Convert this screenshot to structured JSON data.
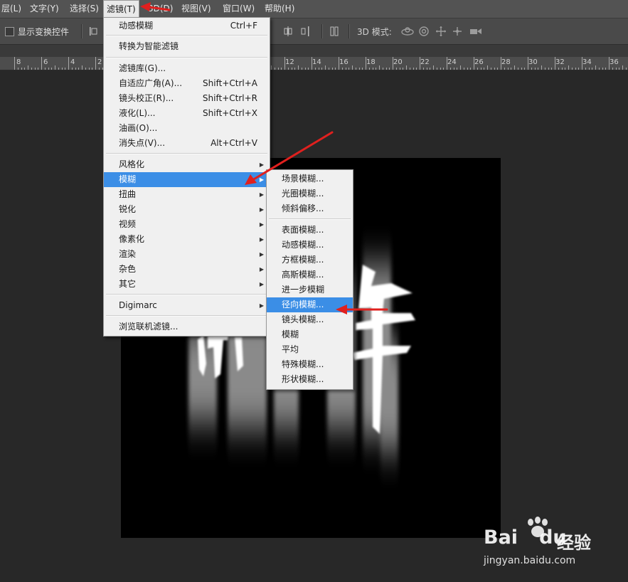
{
  "menubar": {
    "items": [
      "层(L)",
      "文字(Y)",
      "选择(S)",
      "滤镜(T)",
      "3D(D)",
      "视图(V)",
      "窗口(W)",
      "帮助(H)"
    ]
  },
  "options_bar": {
    "show_transform_controls": "显示变换控件",
    "mode_3d": "3D 模式:"
  },
  "ruler": {
    "labels": [
      "8",
      "6",
      "4",
      "2",
      "12",
      "14",
      "16",
      "18",
      "20",
      "22",
      "24",
      "26",
      "28",
      "30",
      "32",
      "34",
      "36"
    ]
  },
  "filter_menu": {
    "last_filter": {
      "label": "动感模糊",
      "shortcut": "Ctrl+F"
    },
    "convert_smart": "转换为智能滤镜",
    "group1": [
      {
        "label": "滤镜库(G)...",
        "shortcut": ""
      },
      {
        "label": "自适应广角(A)...",
        "shortcut": "Shift+Ctrl+A"
      },
      {
        "label": "镜头校正(R)...",
        "shortcut": "Shift+Ctrl+R"
      },
      {
        "label": "液化(L)...",
        "shortcut": "Shift+Ctrl+X"
      },
      {
        "label": "油画(O)...",
        "shortcut": ""
      },
      {
        "label": "消失点(V)...",
        "shortcut": "Alt+Ctrl+V"
      }
    ],
    "group2": [
      "风格化",
      "模糊",
      "扭曲",
      "锐化",
      "视频",
      "像素化",
      "渲染",
      "杂色",
      "其它"
    ],
    "digimarc": "Digimarc",
    "browse_online": "浏览联机滤镜..."
  },
  "blur_submenu": {
    "group1": [
      "场景模糊...",
      "光圈模糊...",
      "倾斜偏移..."
    ],
    "group2": [
      "表面模糊...",
      "动感模糊...",
      "方框模糊...",
      "高斯模糊...",
      "进一步模糊",
      "径向模糊...",
      "镜头模糊...",
      "模糊",
      "平均",
      "特殊模糊...",
      "形状模糊..."
    ]
  },
  "watermark": {
    "brand": "Bai",
    "brand2": "du",
    "product": "经验",
    "url": "jingyan.baidu.com"
  },
  "colors": {
    "highlight": "#3b8ee6",
    "annotation_arrow": "#e0201e",
    "menubar": "#535353",
    "workspace": "#282828"
  }
}
